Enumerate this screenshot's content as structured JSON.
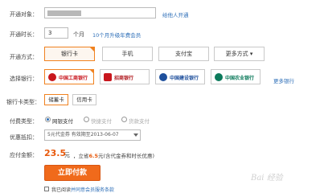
{
  "rows": {
    "target_label": "开通对象：",
    "gift_link": "给他人开通",
    "duration_label": "开通时长：",
    "duration_value": "3",
    "duration_unit": "个月",
    "upgrade_link": "10个月升级年费会员",
    "method_label": "开通方式：",
    "bank_label": "选择银行：",
    "card_type_label": "银行卡类型：",
    "pay_type_label": "付费类型：",
    "coupon_label": "优惠抵扣：",
    "amount_label": "应付金额："
  },
  "tabs": [
    "银行卡",
    "手机",
    "支付宝",
    "更多方式 ▾"
  ],
  "banks": {
    "icbc": "中国工商银行",
    "cmb": "招商银行",
    "ccb": "中国建设银行",
    "abc": "中国农业银行",
    "more": "更多银行"
  },
  "card_types": [
    "储蓄卡",
    "信用卡"
  ],
  "pay_types": [
    "网银支付",
    "快捷支付",
    "货款支付"
  ],
  "coupon": {
    "value": "5元代金券 有效期至2013-06-07"
  },
  "amount": {
    "value": "23.5",
    "unit": "元",
    "saving_prefix": "，立省",
    "saving_value": "6.5",
    "saving_suffix": "元(含代金券和时长优惠)"
  },
  "pay_button": "立即付款",
  "agreement": {
    "prefix": "我已阅读",
    "link": "并同意会员服务条款"
  },
  "watermark": "Bai 经验",
  "colors": {
    "accent": "#f08220",
    "link": "#2e6fb8",
    "price": "#e8590c",
    "button": "#f06a1b"
  }
}
